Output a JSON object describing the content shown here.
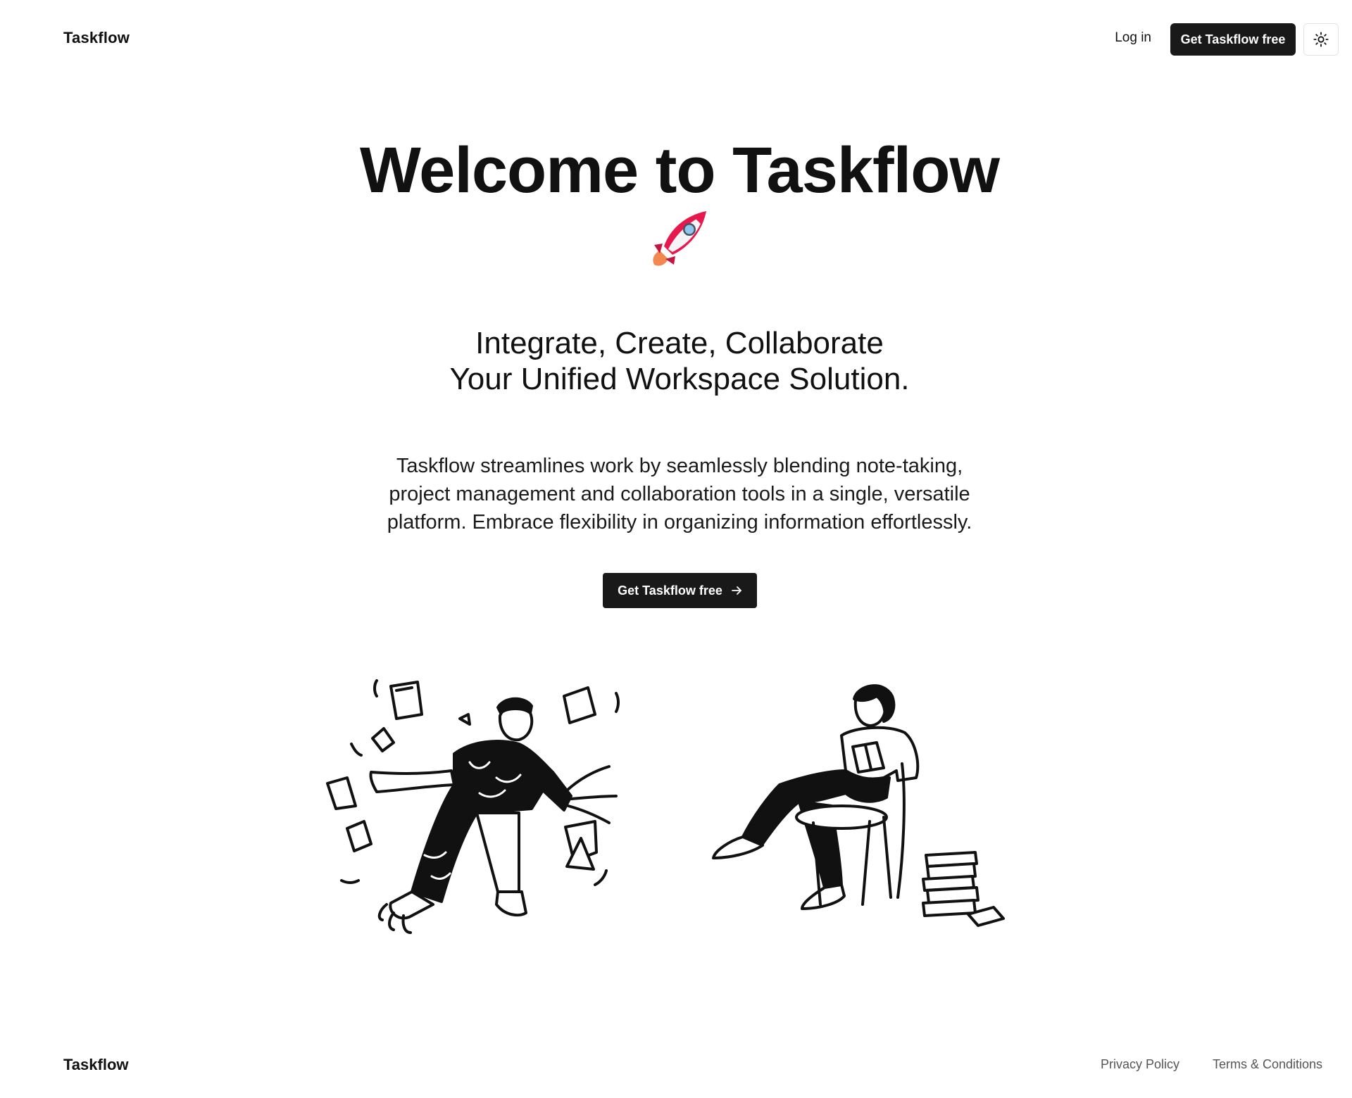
{
  "header": {
    "logo": "Taskflow",
    "login_label": "Log in",
    "cta_label": "Get Taskflow free",
    "theme_icon": "sun-icon"
  },
  "hero": {
    "title": "Welcome to Taskflow",
    "title_emoji_icon": "rocket-icon",
    "subtitle_line1": "Integrate, Create, Collaborate",
    "subtitle_line2": "Your Unified Workspace Solution.",
    "description_line1": "Taskflow streamlines work by seamlessly blending note-taking,",
    "description_line2": "project management and collaboration tools in a single, versatile",
    "description_line3": "platform. Embrace flexibility in organizing information effortlessly.",
    "cta_label": "Get Taskflow free",
    "cta_icon": "arrow-right-icon"
  },
  "illustration": {
    "left_figure": "man-running-with-papers-illustration",
    "right_figure": "woman-reading-in-chair-illustration"
  },
  "footer": {
    "logo": "Taskflow",
    "links": [
      "Privacy Policy",
      "Terms & Conditions"
    ]
  },
  "colors": {
    "background": "#ffffff",
    "text": "#111111",
    "button": "#191919",
    "muted": "#555555",
    "rocket_body": "#e8184d"
  }
}
